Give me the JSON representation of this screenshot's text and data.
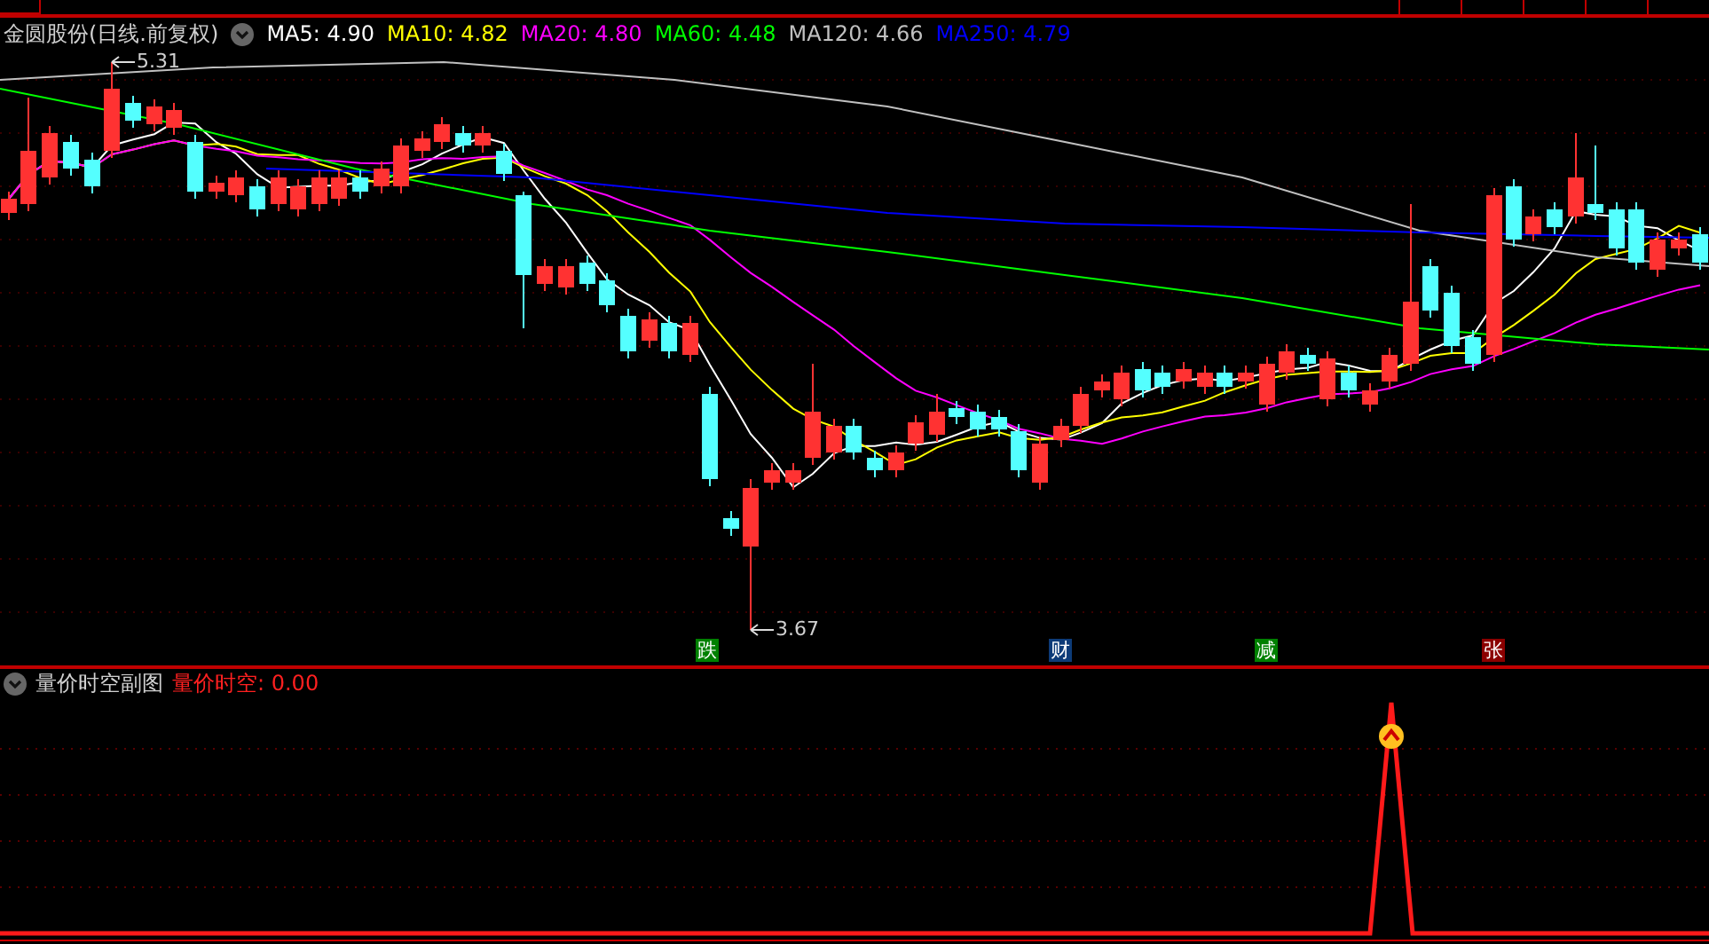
{
  "main_chart": {
    "title": "金圆股份(日线.前复权)",
    "moving_averages": [
      {
        "label": "MA5: 4.90",
        "color": "#ffffff"
      },
      {
        "label": "MA10: 4.82",
        "color": "#ffff00"
      },
      {
        "label": "MA20: 4.80",
        "color": "#ff00ff"
      },
      {
        "label": "MA60: 4.48",
        "color": "#00ff00"
      },
      {
        "label": "MA120: 4.66",
        "color": "#c0c0c0"
      },
      {
        "label": "MA250: 4.79",
        "color": "#0000ff"
      }
    ],
    "high_label": "5.31",
    "low_label": "3.67",
    "markers": [
      {
        "text": "跌",
        "color": "#008000"
      },
      {
        "text": "财",
        "color": "#0d3b78"
      },
      {
        "text": "减",
        "color": "#008000"
      },
      {
        "text": "张",
        "color": "#8b0000"
      }
    ]
  },
  "sub_chart": {
    "title": "量价时空副图",
    "indicator": "量价时空: 0.00"
  }
}
